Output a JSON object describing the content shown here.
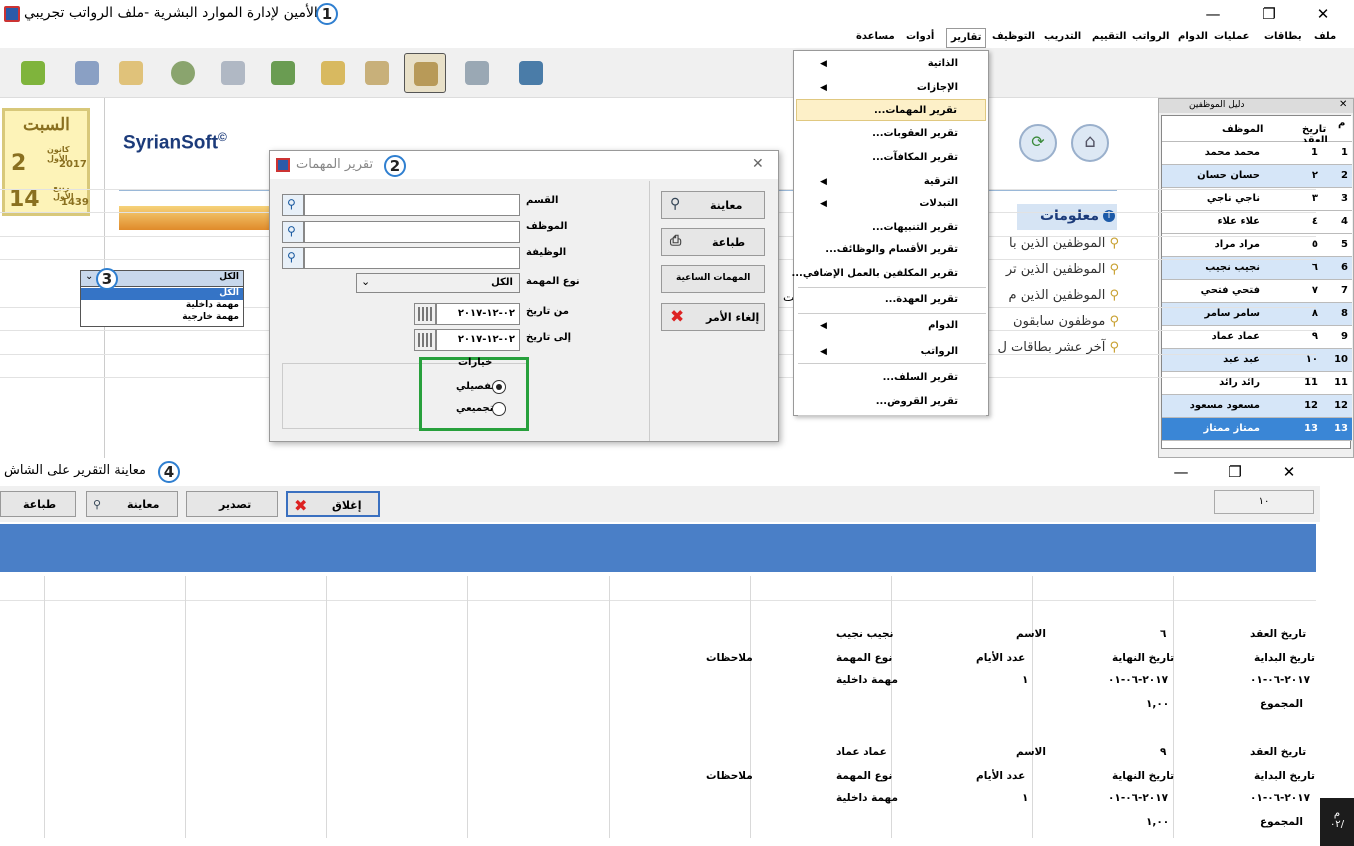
{
  "window": {
    "title": "الأمين لإدارة الموارد البشرية -ملف الرواتب تجريبي",
    "step1": "1",
    "min": "—",
    "max": "❐",
    "close": "✕"
  },
  "menubar": [
    "ملف",
    "بطاقات",
    "عمليات",
    "الدوام",
    "الرواتب",
    "التقييم",
    "التدريب",
    "التوظيف",
    "تقارير",
    "أدوات",
    "مساعدة"
  ],
  "calendar": {
    "day": "السبت",
    "greg_day": "2",
    "greg_month": "كانون الأول",
    "greg_year": "2017",
    "hijri_day": "14",
    "hijri_month": "ربيع الأول",
    "hijri_year": "1439"
  },
  "main": {
    "logo": "SyrianSoft",
    "logo_mark": "©",
    "info_title": "معلومات",
    "info_items": [
      "الموظفين الذين با",
      "الموظفين الذين تر",
      "الموظفين الذين م",
      "موظفون سابقون",
      "آخر عشر بطاقات ل"
    ],
    "partial_text": "بت"
  },
  "employees": {
    "title": "دليل الموظفين",
    "close": "✕",
    "headers": {
      "num": "م",
      "date": "تاريخ العقد",
      "name": "الموظف"
    },
    "rows": [
      {
        "num": "1",
        "date": "1",
        "name": "محمد محمد"
      },
      {
        "num": "2",
        "date": "٢",
        "name": "حسان حسان"
      },
      {
        "num": "3",
        "date": "٣",
        "name": "ناجي ناجي"
      },
      {
        "num": "4",
        "date": "٤",
        "name": "علاء علاء"
      },
      {
        "num": "5",
        "date": "٥",
        "name": "مراد مراد"
      },
      {
        "num": "6",
        "date": "٦",
        "name": "نجيب نجيب"
      },
      {
        "num": "7",
        "date": "٧",
        "name": "فتحي فتحي"
      },
      {
        "num": "8",
        "date": "٨",
        "name": "سامر سامر"
      },
      {
        "num": "9",
        "date": "٩",
        "name": "عماد عماد"
      },
      {
        "num": "10",
        "date": "١٠",
        "name": "عبد عبد"
      },
      {
        "num": "11",
        "date": "11",
        "name": "رائد رائد"
      },
      {
        "num": "12",
        "date": "12",
        "name": "مسعود مسعود"
      },
      {
        "num": "13",
        "date": "13",
        "name": "ممتاز ممتاز"
      }
    ]
  },
  "reports_menu": {
    "items": [
      {
        "label": "الذاتية",
        "submenu": true
      },
      {
        "label": "الإجازات",
        "submenu": true
      },
      {
        "label": "تقرير المهمات...",
        "submenu": false
      },
      {
        "label": "تقرير العقوبات...",
        "submenu": false
      },
      {
        "label": "تقرير المكافآت...",
        "submenu": false
      },
      {
        "label": "الترقية",
        "submenu": true
      },
      {
        "label": "التبدلات",
        "submenu": true
      },
      {
        "label": "تقرير التنبيهات...",
        "submenu": false
      },
      {
        "label": "تقرير الأقسام والوظائف...",
        "submenu": false
      },
      {
        "label": "تقرير المكلفين بالعمل الإضافي...",
        "submenu": false
      },
      {
        "label": "تقرير العهدة...",
        "submenu": false
      },
      {
        "label": "الدوام",
        "submenu": true
      },
      {
        "label": "الرواتب",
        "submenu": true
      },
      {
        "label": "تقرير السلف...",
        "submenu": false
      },
      {
        "label": "تقرير القروض...",
        "submenu": false
      }
    ]
  },
  "dialog": {
    "title": "تقرير المهمات",
    "step": "2",
    "close": "✕",
    "labels": {
      "department": "القسم",
      "employee": "الموظف",
      "job": "الوظيفة",
      "task_type": "نوع المهمة",
      "from_date": "من تاريخ",
      "to_date": "إلى تاريخ",
      "options": "خيارات",
      "detailed": "تفصيلي",
      "aggregate": "تجميعي"
    },
    "task_type_value": "الكل",
    "from_value": "٠٢-١٢-٢٠١٧",
    "to_value": "٠٢-١٢-٢٠١٧",
    "buttons": {
      "preview": "معاينة",
      "print": "طباعة",
      "hourly": "المهمات الساعية",
      "cancel": "إلغاء الأمر"
    }
  },
  "combo": {
    "step": "3",
    "value": "الكل",
    "options": [
      "الكل",
      "مهمة داخلية",
      "مهمة خارجية"
    ]
  },
  "report": {
    "title": "معاينة التقرير على الشاش",
    "step": "4",
    "page": "١٠",
    "buttons": {
      "close": "إغلاق",
      "export": "تصدير",
      "preview": "معاينة",
      "print": "طباعة"
    },
    "blocks": [
      {
        "contract_label": "تاريخ العقد",
        "contract_value": "٦",
        "name_label": "الاسم",
        "name_value": "نجيب نجيب",
        "start_label": "تاريخ البداية",
        "end_label": "تاريخ النهاية",
        "days_label": "عدد الأيام",
        "type_label": "نوع المهمة",
        "notes_label": "ملاحظات",
        "start_value": "٢٠١٧-٠٦-٠١",
        "end_value": "٢٠١٧-٠٦-٠١",
        "days_value": "١",
        "type_value": "مهمة داخلية",
        "total_label": "المجموع",
        "total_value": "١,٠٠"
      },
      {
        "contract_label": "تاريخ العقد",
        "contract_value": "٩",
        "name_label": "الاسم",
        "name_value": "عماد عماد",
        "start_label": "تاريخ البداية",
        "end_label": "تاريخ النهاية",
        "days_label": "عدد الأيام",
        "type_label": "نوع المهمة",
        "notes_label": "ملاحظات",
        "start_value": "٢٠١٧-٠٦-٠١",
        "end_value": "٢٠١٧-٠٦-٠١",
        "days_value": "١",
        "type_value": "مهمة داخلية",
        "total_label": "المجموع",
        "total_value": "١,٠٠"
      }
    ]
  },
  "taskbar": {
    "line1": "م",
    "line2": "٠٢/"
  }
}
